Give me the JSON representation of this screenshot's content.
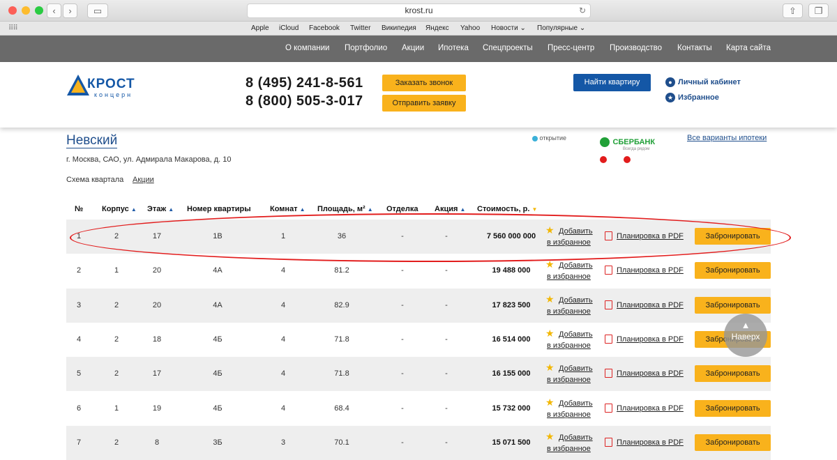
{
  "browser": {
    "address": "krost.ru",
    "favorites": [
      "Apple",
      "iCloud",
      "Facebook",
      "Twitter",
      "Википедия",
      "Яндекс",
      "Yahoo",
      "Новости",
      "Популярные"
    ]
  },
  "topnav": [
    "О компании",
    "Портфолио",
    "Акции",
    "Ипотека",
    "Спецпроекты",
    "Пресс-центр",
    "Производство",
    "Контакты",
    "Карта сайта"
  ],
  "header": {
    "logo_main": "КРОСТ",
    "logo_sub": "концерн",
    "phone1": "8 (495) 241-8-561",
    "phone2": "8 (800) 505-3-017",
    "call_btn": "Заказать звонок",
    "request_btn": "Отправить заявку",
    "find_btn": "Найти квартиру",
    "cabinet": "Личный кабинет",
    "favorites": "Избранное"
  },
  "project": {
    "title": "Невский",
    "address": "г. Москва, САО, ул. Адмирала Макарова, д. 10",
    "scheme": "Схема квартала",
    "promo": "Акции",
    "bank1": "открытие",
    "bank2": "СБЕРБАНК",
    "bank2_sub": "Всегда рядом",
    "mortgage_link": "Все варианты ипотеки"
  },
  "table": {
    "headers": [
      "№",
      "Корпус",
      "Этаж",
      "Номер квартиры",
      "Комнат",
      "Площадь, м²",
      "Отделка",
      "Акция",
      "Стоимость, р."
    ],
    "fav_label_1": "Добавить",
    "fav_label_2": "в избранное",
    "pdf_label": "Планировка в PDF",
    "book_label": "Забронировать",
    "rows": [
      [
        "1",
        "2",
        "17",
        "1В",
        "1",
        "36",
        "-",
        "-",
        "7 560 000 000"
      ],
      [
        "2",
        "1",
        "20",
        "4А",
        "4",
        "81.2",
        "-",
        "-",
        "19 488 000"
      ],
      [
        "3",
        "2",
        "20",
        "4А",
        "4",
        "82.9",
        "-",
        "-",
        "17 823 500"
      ],
      [
        "4",
        "2",
        "18",
        "4Б",
        "4",
        "71.8",
        "-",
        "-",
        "16 514 000"
      ],
      [
        "5",
        "2",
        "17",
        "4Б",
        "4",
        "71.8",
        "-",
        "-",
        "16 155 000"
      ],
      [
        "6",
        "1",
        "19",
        "4Б",
        "4",
        "68.4",
        "-",
        "-",
        "15 732 000"
      ],
      [
        "7",
        "2",
        "8",
        "3Б",
        "3",
        "70.1",
        "-",
        "-",
        "15 071 500"
      ]
    ]
  },
  "totop_label": "Наверх",
  "colors": {
    "accent": "#f9b21c",
    "brand_blue": "#1457a6",
    "nav_bg": "#6a6a6a",
    "highlight": "#e21c1c"
  }
}
